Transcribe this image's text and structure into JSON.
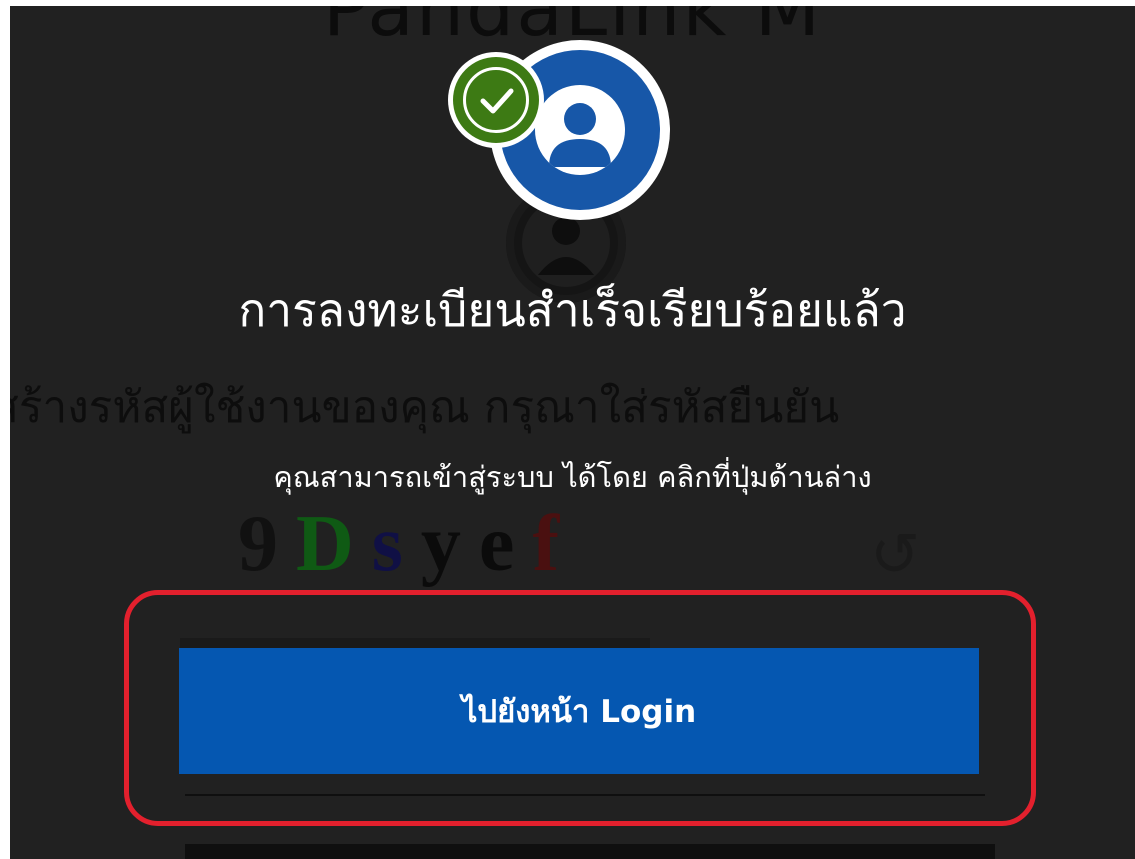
{
  "background": {
    "app_title": "PandaLink M",
    "description": "สร้างรหัสผู้ใช้งานของคุณ กรุณาใส่รหัสยืนยัน",
    "captcha": {
      "characters": [
        "9",
        "D",
        "s",
        "y",
        "e",
        "f"
      ],
      "colors": [
        "#111111",
        "#0f5a14",
        "#101045",
        "#0b0b0b",
        "#0b0b0b",
        "#4a1010"
      ]
    },
    "refresh_glyph": "↺"
  },
  "modal": {
    "title": "การลงทะเบียนสำเร็จเรียบร้อยแล้ว",
    "subtitle": "คุณสามารถเข้าสู่ระบบ ได้โดย คลิกที่ปุ่มด้านล่าง",
    "login_button_label": "ไปยังหน้า Login",
    "icons": {
      "avatar": "user-avatar-icon",
      "badge": "check-circle-icon"
    }
  },
  "colors": {
    "overlay": "#212121",
    "primary_button": "#0557b1",
    "avatar_ring": "#1757a8",
    "success_badge": "#3d7a14",
    "highlight_frame": "#e3202d"
  }
}
